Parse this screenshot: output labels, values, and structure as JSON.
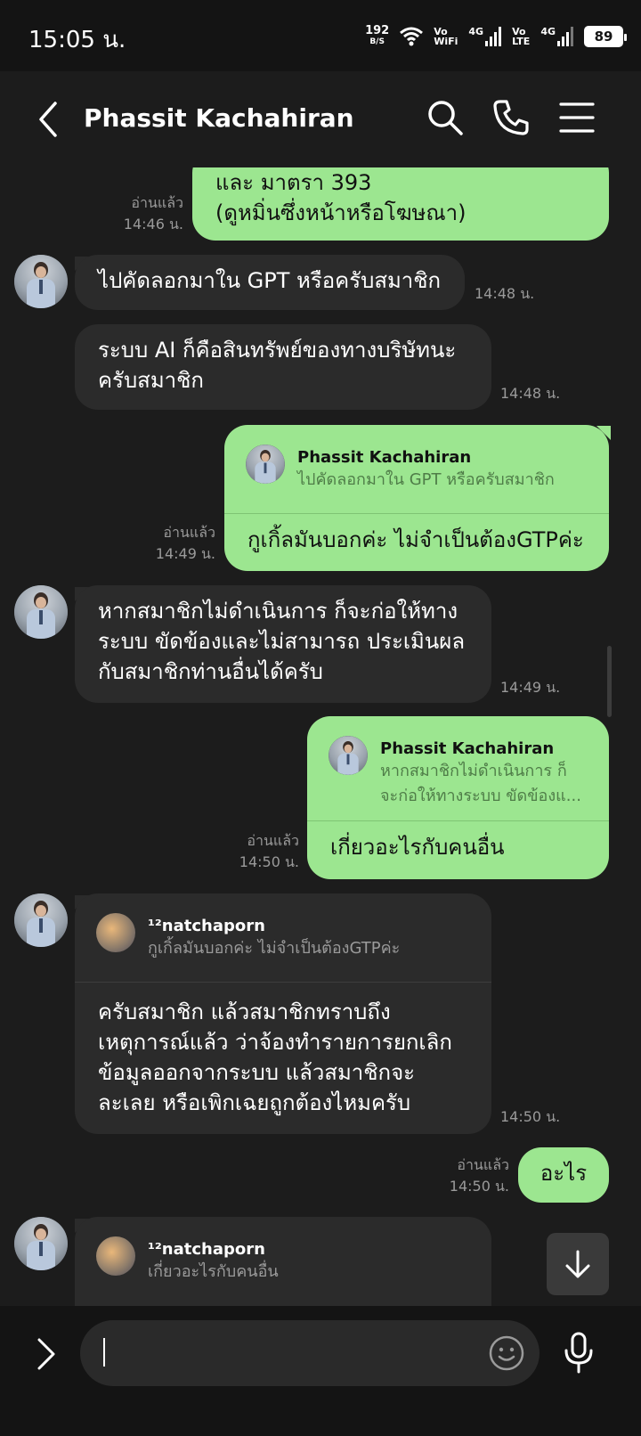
{
  "status_bar": {
    "time": "15:05 น.",
    "net_speed": "192",
    "net_unit": "B/S",
    "vowifi_top": "Vo",
    "vowifi_bottom": "WiFi",
    "net1": "4G",
    "volte_top": "Vo",
    "volte_bottom": "LTE",
    "net2": "4G",
    "battery": "89"
  },
  "header": {
    "title": "Phassit Kachahiran",
    "icons": [
      "back-icon",
      "search-icon",
      "phone-icon",
      "menu-icon"
    ]
  },
  "messages": {
    "m1": {
      "line1": "และ มาตรา 393",
      "line2": "(ดูหมิ่นซึ่งหน้าหรือโฆษณา)",
      "read": "อ่านแล้ว",
      "time": "14:46 น."
    },
    "m2": {
      "text": "ไปคัดลอกมาใน GPT หรือครับสมาชิก",
      "time": "14:48 น."
    },
    "m3": {
      "line1": "ระบบ AI ก็คือสินทรัพย์ของทางบริษัทนะ",
      "line2": "ครับสมาชิก",
      "time": "14:48 น."
    },
    "m4": {
      "reply_name": "Phassit Kachahiran",
      "reply_text": "ไปคัดลอกมาใน GPT หรือครับสมาชิก",
      "text": "กูเกิ้ลมันบอกค่ะ ไม่จำเป็นต้องGTPค่ะ",
      "read": "อ่านแล้ว",
      "time": "14:49 น."
    },
    "m5": {
      "line1": "หากสมาชิกไม่ดำเนินการ ก็จะก่อให้ทาง",
      "line2": "ระบบ ขัดข้องและไม่สามารถ ประเมินผล",
      "line3": "กับสมาชิกท่านอื่นได้ครับ",
      "time": "14:49 น."
    },
    "m6": {
      "reply_name": "Phassit Kachahiran",
      "reply_line1": "หากสมาชิกไม่ดำเนินการ ก็",
      "reply_line2": "จะก่อให้ทางระบบ ขัดข้องแ...",
      "text": "เกี่ยวอะไรกับคนอื่น",
      "read": "อ่านแล้ว",
      "time": "14:50 น."
    },
    "m7": {
      "reply_name": "¹²natchaporn",
      "reply_text": "กูเกิ้ลมันบอกค่ะ ไม่จำเป็นต้องGTPค่ะ",
      "line1": "ครับสมาชิก แล้วสมาชิกทราบถึง",
      "line2": "เหตุการณ์แล้ว ว่าจ้องทำรายการยกเลิก",
      "line3": "ข้อมูลออกจากระบบ แล้วสมาชิกจะ",
      "line4": "ละเลย หรือเพิกเฉยถูกต้องไหมครับ",
      "time": "14:50 น."
    },
    "m8": {
      "text": "อะไร",
      "read": "อ่านแล้ว",
      "time": "14:50 น."
    },
    "m9": {
      "reply_name": "¹²natchaporn",
      "reply_text": "เกี่ยวอะไรกับคนอื่น"
    }
  },
  "input": {
    "placeholder": ""
  },
  "colors": {
    "incoming_bubble": "#2b2b2b",
    "outgoing_bubble": "#9ce690",
    "background": "#1c1c1c"
  }
}
